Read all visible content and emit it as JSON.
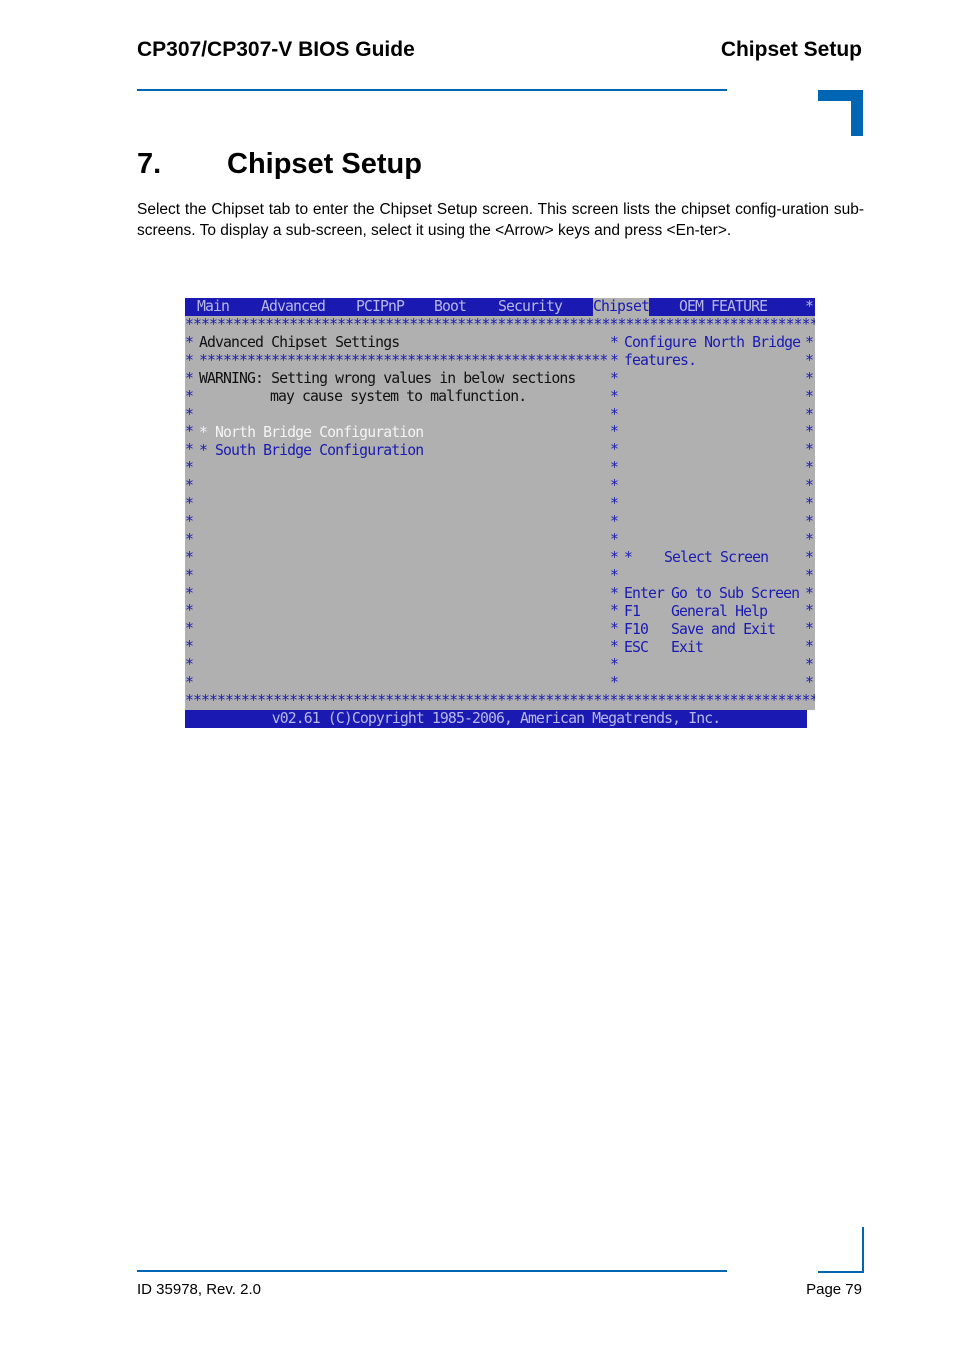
{
  "header": {
    "doc_title": "CP307/CP307-V BIOS Guide",
    "section_title": "Chipset Setup"
  },
  "chapter": {
    "number": "7.",
    "title": "Chipset Setup"
  },
  "intro": "Select the Chipset tab to enter the Chipset Setup screen. This screen lists the chipset config-uration sub-screens. To display a sub-screen, select it using the <Arrow> keys and press <En-ter>.",
  "bios": {
    "tabs": [
      {
        "label": "Main",
        "active": false
      },
      {
        "label": "Advanced",
        "active": false
      },
      {
        "label": "PCIPnP",
        "active": false
      },
      {
        "label": "Boot",
        "active": false
      },
      {
        "label": "Security",
        "active": false
      },
      {
        "label": "Chipset",
        "active": true
      },
      {
        "label": "OEM FEATURE",
        "active": false
      }
    ],
    "menu_edge": "*",
    "panel_title": "Advanced Chipset Settings",
    "warning_line1": "WARNING: Setting wrong values in below sections",
    "warning_line2": "may cause system to malfunction.",
    "items": [
      {
        "label": "North Bridge Configuration",
        "selected": true
      },
      {
        "label": "South Bridge Configuration",
        "selected": false
      }
    ],
    "help_text_line1": "Configure North Bridge",
    "help_text_line2": "features.",
    "keys": [
      {
        "key": "*",
        "action": "Select Screen"
      },
      {
        "key": "Enter",
        "action": "Go to Sub Screen"
      },
      {
        "key": "F1",
        "action": "General Help"
      },
      {
        "key": "F10",
        "action": "Save and Exit"
      },
      {
        "key": "ESC",
        "action": "Exit"
      }
    ],
    "footer": "v02.61 (C)Copyright 1985-2006, American Megatrends, Inc."
  },
  "footer": {
    "doc_id": "ID 35978, Rev. 2.0",
    "page": "Page 79"
  },
  "colors": {
    "accent": "#0066b3",
    "bios_blue": "#1a1ab3",
    "bios_gray": "#b0b0b0"
  }
}
